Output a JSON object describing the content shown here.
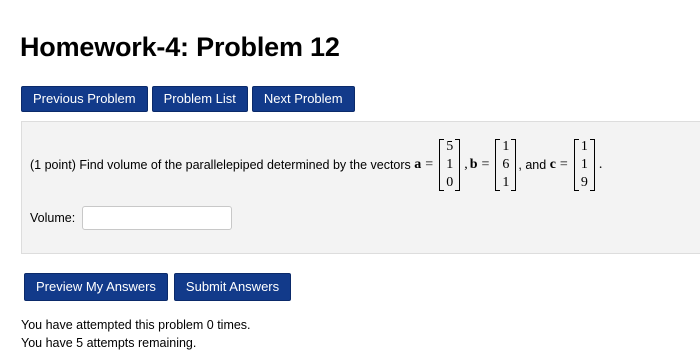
{
  "page": {
    "title": "Homework-4: Problem 12"
  },
  "nav": {
    "previous": "Previous Problem",
    "list": "Problem List",
    "next": "Next Problem"
  },
  "problem": {
    "points": "(1 point)",
    "text": "Find volume of the parallelepiped determined by the vectors",
    "a_name": "a",
    "b_name": "b",
    "c_name": "c",
    "equals": "=",
    "comma": ",",
    "and_text": ", and",
    "period": ".",
    "vector_a": [
      "5",
      "1",
      "0"
    ],
    "vector_b": [
      "1",
      "6",
      "1"
    ],
    "vector_c": [
      "1",
      "1",
      "9"
    ],
    "answer_label": "Volume:",
    "answer_value": ""
  },
  "actions": {
    "preview": "Preview My Answers",
    "submit": "Submit Answers"
  },
  "status": {
    "attempted": "You have attempted this problem 0 times.",
    "remaining": "You have 5 attempts remaining."
  },
  "colors": {
    "button_bg": "#123a8a",
    "panel_bg": "#f3f3f3"
  }
}
